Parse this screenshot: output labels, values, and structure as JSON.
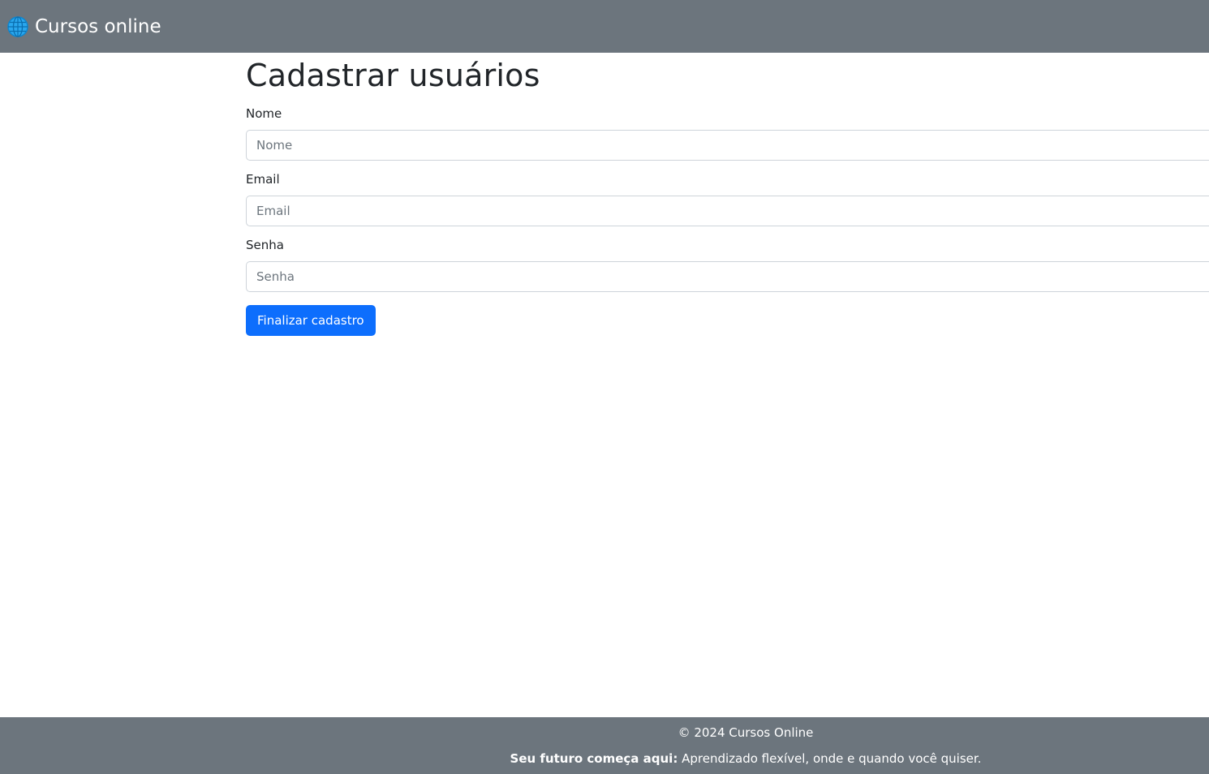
{
  "navbar": {
    "brand_label": "Cursos online",
    "brand_icon": "globe-icon",
    "brand_icon_color": "#0d9ae8"
  },
  "form": {
    "title": "Cadastrar usuários",
    "fields": [
      {
        "label": "Nome",
        "placeholder": "Nome",
        "value": ""
      },
      {
        "label": "Email",
        "placeholder": "Email",
        "value": ""
      },
      {
        "label": "Senha",
        "placeholder": "Senha",
        "value": ""
      }
    ],
    "submit_label": "Finalizar cadastro"
  },
  "footer": {
    "copyright": "© 2024 Cursos Online",
    "tagline_bold": "Seu futuro começa aqui:",
    "tagline_text": " Aprendizado flexível, onde e quando você quiser."
  },
  "colors": {
    "header_bg": "#6c757d",
    "footer_bg": "#6c757d",
    "primary": "#0d6efd"
  }
}
